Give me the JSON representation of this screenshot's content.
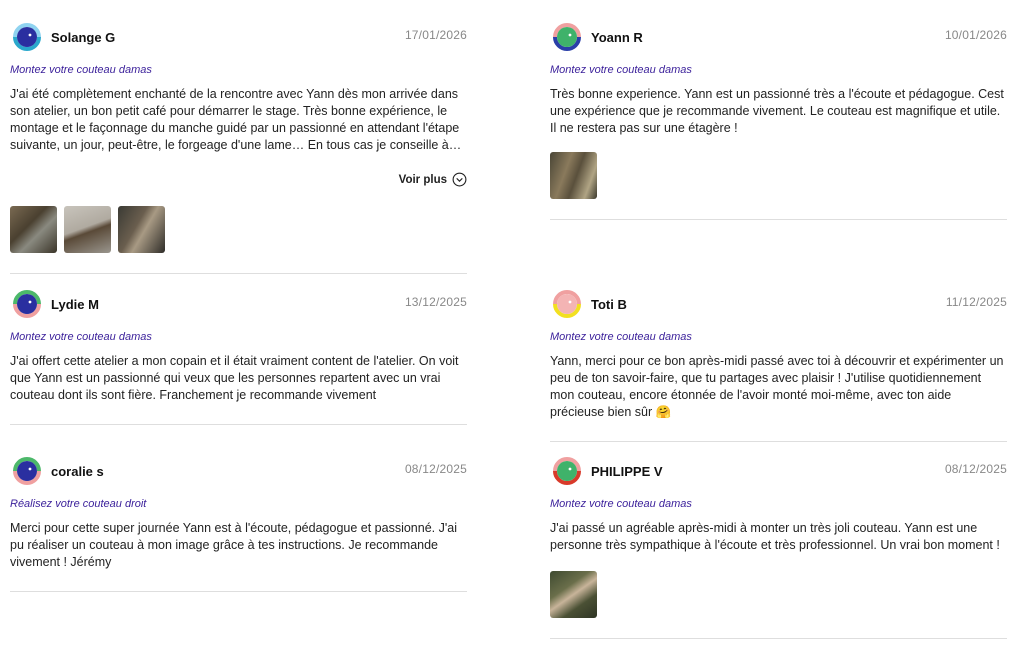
{
  "reviews": [
    {
      "name": "Solange G",
      "date": "17/01/2026",
      "product": "Montez votre couteau damas",
      "text": "J'ai été complètement enchanté de la rencontre avec Yann dès mon arrivée dans son atelier, un bon petit café pour démarrer le stage. Très bonne expérience, le montage et le façonnage du manche guidé par un passionné en attendant l'étape suivante, un jour, peut-être, le forgeage d'une lame… En tous cas je conseille à…",
      "more_label": "Voir plus",
      "photos": 3,
      "ring": [
        "#8fd3f0",
        "#2aa8cc"
      ]
    },
    {
      "name": "Yoann R",
      "date": "10/01/2026",
      "product": "Montez votre couteau damas",
      "text": "Très bonne experience. Yann est un passionné très a l'écoute et pédagogue. Cest une expérience que je recommande vivement. Le couteau est magnifique et utile. Il ne restera pas sur une étagère !",
      "photos": 1,
      "ring": [
        "#f0a0a0",
        "#2a3fa8"
      ]
    },
    {
      "name": "Lydie M",
      "date": "13/12/2025",
      "product": "Montez votre couteau damas",
      "text": "J'ai offert cette atelier a mon copain et il était vraiment content de l'atelier. On voit que Yann est un passionné qui veux que les personnes repartent avec un vrai couteau dont ils sont fière. Franchement je recommande vivement",
      "photos": 0,
      "ring": [
        "#4cb86a",
        "#f0a0a0"
      ]
    },
    {
      "name": "Toti B",
      "date": "11/12/2025",
      "product": "Montez votre couteau damas",
      "text": "Yann, merci pour ce bon après-midi passé avec toi à découvrir et expérimenter un peu de ton savoir-faire, que tu partages avec plaisir ! J'utilise quotidiennement mon couteau, encore étonnée de l'avoir monté moi-même, avec ton aide précieuse bien sûr 🤗",
      "photos": 0,
      "ring": [
        "#f0a0a0",
        "#f2e020"
      ]
    },
    {
      "name": "coralie s",
      "date": "08/12/2025",
      "product": "Réalisez votre couteau droit",
      "text": "Merci pour cette super journée Yann est à l'écoute, pédagogue et passionné. J'ai pu réaliser un couteau à mon image grâce à tes instructions. Je recommande vivement ! Jérémy",
      "photos": 0,
      "ring": [
        "#4cb86a",
        "#f0a0a0"
      ]
    },
    {
      "name": "PHILIPPE V",
      "date": "08/12/2025",
      "product": "Montez votre couteau damas",
      "text": "J'ai passé un agréable après-midi à monter un très joli couteau. Yann est une personne très sympathique à l'écoute et très professionnel. Un vrai bon moment !",
      "photos": 1,
      "ring": [
        "#f0a0a0",
        "#d83a2a"
      ]
    }
  ],
  "icons": {
    "chevron": "chevron-down-circle-icon",
    "avatar_face": "avatar-face-icon"
  },
  "colors": {
    "product_link": "#3a1f9a",
    "date": "#888888",
    "divider": "#dedede"
  }
}
